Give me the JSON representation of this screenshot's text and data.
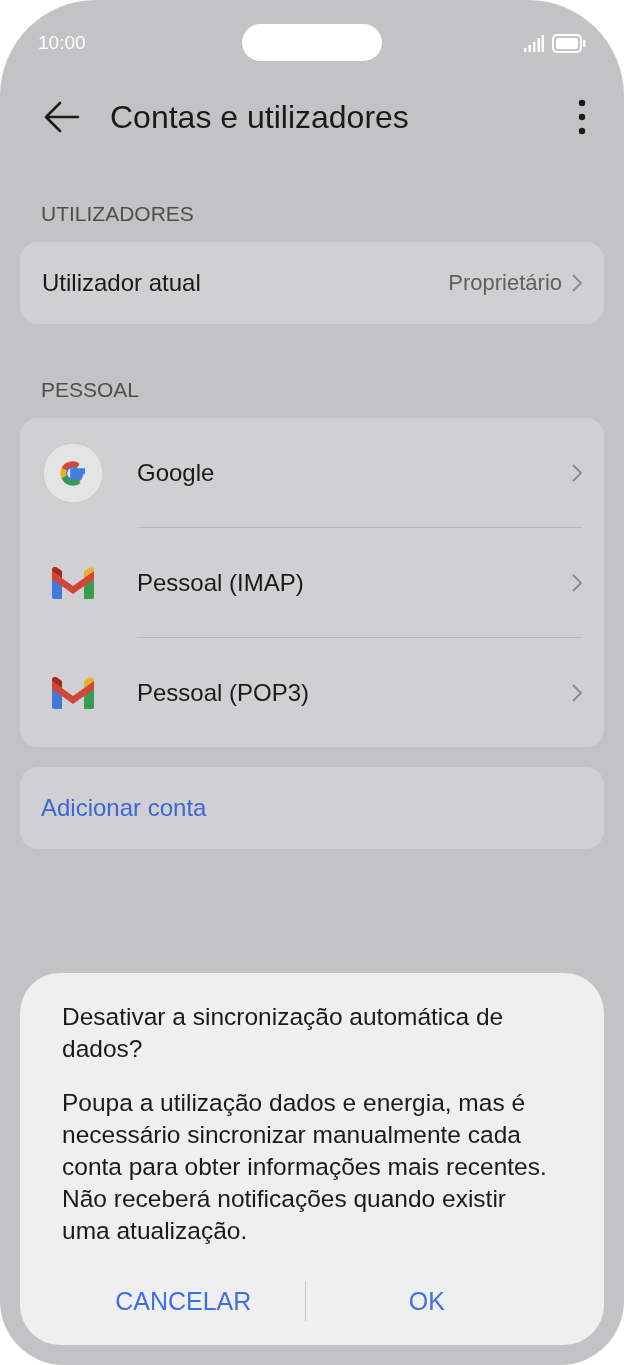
{
  "status_bar": {
    "time": "10:00"
  },
  "header": {
    "title": "Contas e utilizadores"
  },
  "sections": [
    {
      "title": "UTILIZADORES",
      "kind": "user",
      "items": [
        {
          "label": "Utilizador atual",
          "value": "Proprietário"
        }
      ]
    },
    {
      "title": "PESSOAL",
      "kind": "accounts",
      "items": [
        {
          "label": "Google",
          "kind": "google"
        },
        {
          "label": "Pessoal (IMAP)",
          "kind": "gmail"
        },
        {
          "label": "Pessoal (POP3)",
          "kind": "gmail"
        }
      ]
    }
  ],
  "add_account": "Adicionar conta",
  "dialog": {
    "title": "Desativar a sincronização automática de dados?",
    "message": "Poupa a utilização dados e energia, mas é necessário sincronizar manualmente cada conta para obter informações mais recentes. Não receberá notificações quando existir uma atualização.",
    "buttons": [
      "CANCELAR",
      "OK"
    ]
  }
}
